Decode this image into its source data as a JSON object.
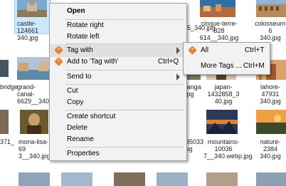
{
  "files": {
    "castle": "castle-124661\n340.jpg",
    "cinque": "cinque-terre-828\n614__340.jpg",
    "colosseum": "colosseum-6\n340.jpg",
    "f340": "05_340.jpg",
    "bridge": "bridge",
    "grand_canal": "grand-canal-\n6629__340.jpg",
    "vanga": "vanga\n.jpg",
    "japan": "japan-1432858_3\n40.jpg",
    "lahore": "lahore-47931\n340.jpg",
    "mona_lisa": "mona-lisa-69\n3__340.jpg",
    "n895": "895033\n.jpg",
    "mountains": "mountains-10036\n7__340.webp.jpg",
    "nature": "nature-2384\n340.jpg",
    "row3_left": "371_"
  },
  "context_menu": {
    "open": "Open",
    "rotate_right": "Rotate right",
    "rotate_left": "Rotate left",
    "tag_with": "Tag with",
    "add_to_tag": "Add to 'Tag with'",
    "add_to_tag_shortcut": "Ctrl+Q",
    "send_to": "Send to",
    "cut": "Cut",
    "copy": "Copy",
    "create_shortcut": "Create shortcut",
    "delete": "Delete",
    "rename": "Rename",
    "properties": "Properties"
  },
  "submenu": {
    "all": "All",
    "all_shortcut": "Ctrl+T",
    "more_tags": "More Tags ...",
    "more_tags_shortcut": "Ctrl+M"
  },
  "colors": {
    "tag_icon": "#e8832a",
    "selection": "#cce8ff",
    "menu_bg": "#f2f2f2"
  }
}
